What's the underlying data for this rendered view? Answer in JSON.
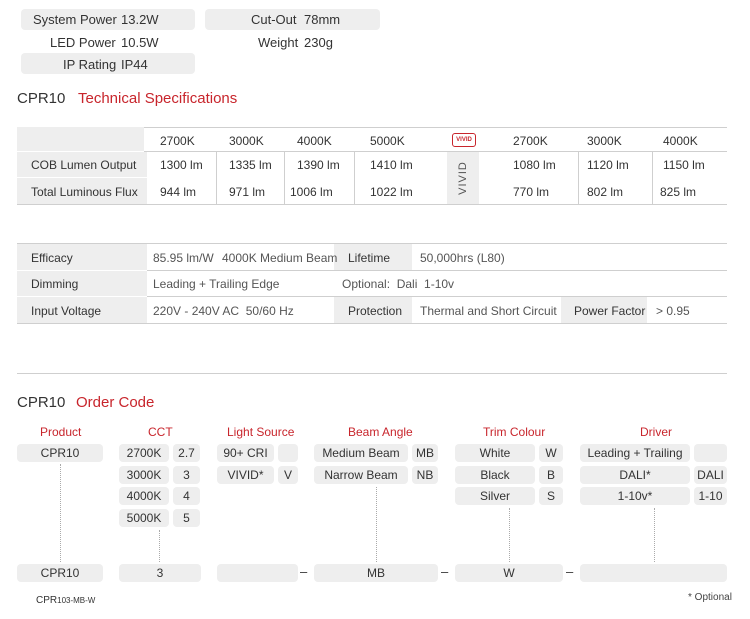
{
  "top_specs": {
    "system_power": {
      "label": "System Power",
      "value": "13.2W"
    },
    "led_power": {
      "label": "LED Power",
      "value": "10.5W"
    },
    "ip_rating": {
      "label": "IP Rating",
      "value": "IP44"
    },
    "cut_out": {
      "label": "Cut-Out",
      "value": "78mm"
    },
    "weight": {
      "label": "Weight",
      "value": "230g"
    }
  },
  "tech": {
    "model": "CPR10",
    "title": "Technical Specifications",
    "std_headers": [
      "2700K",
      "3000K",
      "4000K",
      "5000K"
    ],
    "vivid_headers": [
      "2700K",
      "3000K",
      "4000K"
    ],
    "vivid_label": "VIVID",
    "vivid_logo": "VIVID",
    "rows": [
      {
        "label": "COB Lumen Output",
        "std": [
          "1300 lm",
          "1335 lm",
          "1390 lm",
          "1410 lm"
        ],
        "vivid": [
          "1080 lm",
          "1120 lm",
          "1150 lm"
        ]
      },
      {
        "label": "Total Luminous Flux",
        "std": [
          "944 lm",
          "971 lm",
          "1006 lm",
          "1022 lm"
        ],
        "vivid": [
          "770 lm",
          "802 lm",
          "825 lm"
        ]
      }
    ]
  },
  "specs": {
    "efficacy": {
      "label": "Efficacy",
      "value": "85.95 lm/W",
      "note": "4000K Medium Beam"
    },
    "lifetime": {
      "label": "Lifetime",
      "value": "50,000hrs (L80)"
    },
    "dimming": {
      "label": "Dimming",
      "value": "Leading + Trailing Edge",
      "optional": "Optional:  Dali  1-10v"
    },
    "input_voltage": {
      "label": "Input Voltage",
      "value": "220V - 240V AC  50/60 Hz"
    },
    "protection": {
      "label": "Protection",
      "value": "Thermal and Short Circuit"
    },
    "power_factor": {
      "label": "Power Factor",
      "value": "> 0.95"
    }
  },
  "order": {
    "model": "CPR10",
    "title": "Order Code",
    "headers": {
      "product": "Product",
      "cct": "CCT",
      "light_source": "Light Source",
      "beam_angle": "Beam Angle",
      "trim_colour": "Trim Colour",
      "driver": "Driver"
    },
    "product": "CPR10",
    "cct": [
      [
        "2700K",
        "2.7"
      ],
      [
        "3000K",
        "3"
      ],
      [
        "4000K",
        "4"
      ],
      [
        "5000K",
        "5"
      ]
    ],
    "light_source": [
      [
        "90+ CRI",
        ""
      ],
      [
        "VIVID*",
        "V"
      ]
    ],
    "beam_angle": [
      [
        "Medium Beam",
        "MB"
      ],
      [
        "Narrow Beam",
        "NB"
      ]
    ],
    "trim_colour": [
      [
        "White",
        "W"
      ],
      [
        "Black",
        "B"
      ],
      [
        "Silver",
        "S"
      ]
    ],
    "driver": [
      [
        "Leading + Trailing",
        ""
      ],
      [
        "DALI*",
        "DALI"
      ],
      [
        "1-10v*",
        "1-10"
      ]
    ],
    "result": {
      "product": "CPR10",
      "cct": "3",
      "light_source": "",
      "beam": "MB",
      "trim": "W",
      "driver": "",
      "dash": "–"
    },
    "example_prefix": "CPR",
    "example_suffix": "103-MB-W",
    "footnote": "* Optional"
  }
}
